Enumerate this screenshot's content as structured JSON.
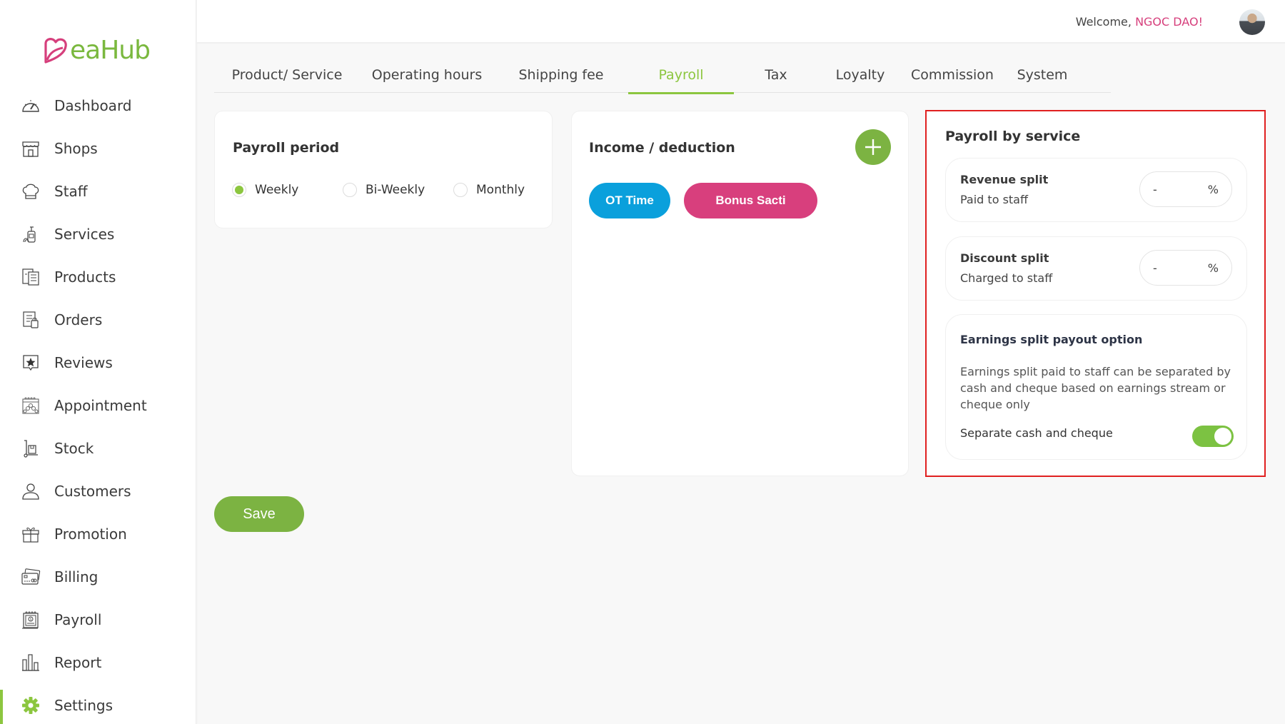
{
  "app": {
    "logo_text": "eaHub",
    "brand_colors": {
      "primary": "#8cc63f",
      "pink": "#d63f7c",
      "blue": "#0aa0dc"
    }
  },
  "header": {
    "welcome_prefix": "Welcome, ",
    "user_name": "NGOC DAO!",
    "avatar_icon": "user-avatar-photo"
  },
  "sidebar": {
    "items": [
      {
        "label": "Dashboard",
        "icon": "speedometer-icon",
        "active": false
      },
      {
        "label": "Shops",
        "icon": "storefront-icon",
        "active": false
      },
      {
        "label": "Staff",
        "icon": "chef-hat-icon",
        "active": false
      },
      {
        "label": "Services",
        "icon": "spa-bottle-icon",
        "active": false
      },
      {
        "label": "Products",
        "icon": "product-list-icon",
        "active": false
      },
      {
        "label": "Orders",
        "icon": "order-checklist-icon",
        "active": false
      },
      {
        "label": "Reviews",
        "icon": "star-review-icon",
        "active": false
      },
      {
        "label": "Appointment",
        "icon": "calendar-flower-icon",
        "active": false
      },
      {
        "label": "Stock",
        "icon": "hand-truck-icon",
        "active": false
      },
      {
        "label": "Customers",
        "icon": "user-icon",
        "active": false
      },
      {
        "label": "Promotion",
        "icon": "gift-icon",
        "active": false
      },
      {
        "label": "Billing",
        "icon": "credit-card-icon",
        "active": false
      },
      {
        "label": "Payroll",
        "icon": "payroll-calendar-icon",
        "active": false
      },
      {
        "label": "Report",
        "icon": "bar-chart-icon",
        "active": false
      },
      {
        "label": "Settings",
        "icon": "gear-icon",
        "active": true
      }
    ]
  },
  "tabs": [
    {
      "label": "Product/ Service",
      "active": false
    },
    {
      "label": "Operating hours",
      "active": false
    },
    {
      "label": "Shipping fee",
      "active": false
    },
    {
      "label": "Payroll",
      "active": true
    },
    {
      "label": "Tax",
      "active": false
    },
    {
      "label": "Loyalty",
      "active": false
    },
    {
      "label": "Commission",
      "active": false
    },
    {
      "label": "System",
      "active": false
    }
  ],
  "payroll_period": {
    "title": "Payroll period",
    "options": [
      {
        "label": "Weekly",
        "selected": true
      },
      {
        "label": "Bi-Weekly",
        "selected": false
      },
      {
        "label": "Monthly",
        "selected": false
      }
    ]
  },
  "income_deduction": {
    "title": "Income / deduction",
    "add_icon": "plus-icon",
    "items": [
      {
        "label": "OT Time",
        "color": "#0aa0dc"
      },
      {
        "label": "Bonus Sacti",
        "color": "#d83f7d"
      }
    ]
  },
  "save_label": "Save",
  "payroll_by_service": {
    "title": "Payroll by service",
    "revenue_split": {
      "title": "Revenue split",
      "subtitle": "Paid to staff",
      "value": "-",
      "unit": "%"
    },
    "discount_split": {
      "title": "Discount split",
      "subtitle": "Charged to staff",
      "value": "-",
      "unit": "%"
    },
    "earnings": {
      "title": "Earnings split payout option",
      "description": "Earnings split paid to staff can be separated by cash and cheque based on earnings stream or cheque only",
      "toggle_label": "Separate cash and cheque",
      "toggle_on": true
    }
  }
}
